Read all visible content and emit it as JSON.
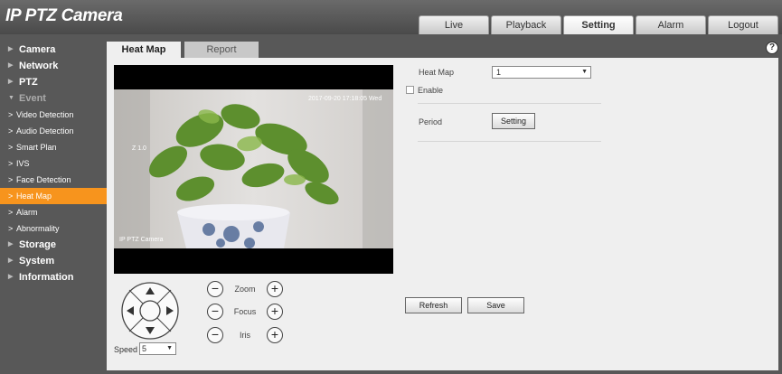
{
  "app": {
    "title": "IP PTZ Camera"
  },
  "top_tabs": [
    {
      "label": "Live"
    },
    {
      "label": "Playback"
    },
    {
      "label": "Setting",
      "active": true
    },
    {
      "label": "Alarm"
    },
    {
      "label": "Logout"
    }
  ],
  "sidebar": {
    "sections": [
      {
        "label": "Camera"
      },
      {
        "label": "Network"
      },
      {
        "label": "PTZ"
      },
      {
        "label": "Event",
        "expanded": true
      },
      {
        "label": "Storage"
      },
      {
        "label": "System"
      },
      {
        "label": "Information"
      }
    ],
    "event_items": [
      {
        "label": "Video Detection"
      },
      {
        "label": "Audio Detection"
      },
      {
        "label": "Smart Plan"
      },
      {
        "label": "IVS"
      },
      {
        "label": "Face Detection"
      },
      {
        "label": "Heat Map",
        "active": true
      },
      {
        "label": "Alarm"
      },
      {
        "label": "Abnormality"
      }
    ]
  },
  "sub_tabs": [
    {
      "label": "Heat Map",
      "active": true
    },
    {
      "label": "Report"
    }
  ],
  "help": {
    "symbol": "?"
  },
  "video": {
    "osd_time": "2017-09-20 17:18:05 Wed",
    "osd_zoom": "Z 1.0",
    "osd_name": "IP PTZ Camera"
  },
  "ptz": {
    "zoom_label": "Zoom",
    "focus_label": "Focus",
    "iris_label": "Iris",
    "speed_label": "Speed",
    "speed_value": "5",
    "minus": "−",
    "plus": "+"
  },
  "form": {
    "heatmap_label": "Heat Map",
    "heatmap_value": "1",
    "enable_label": "Enable",
    "enable_checked": false,
    "period_label": "Period",
    "setting_button": "Setting",
    "refresh_button": "Refresh",
    "save_button": "Save"
  },
  "colors": {
    "accent_orange": "#f7941d",
    "background_dark": "#585858",
    "panel": "#efefef"
  }
}
